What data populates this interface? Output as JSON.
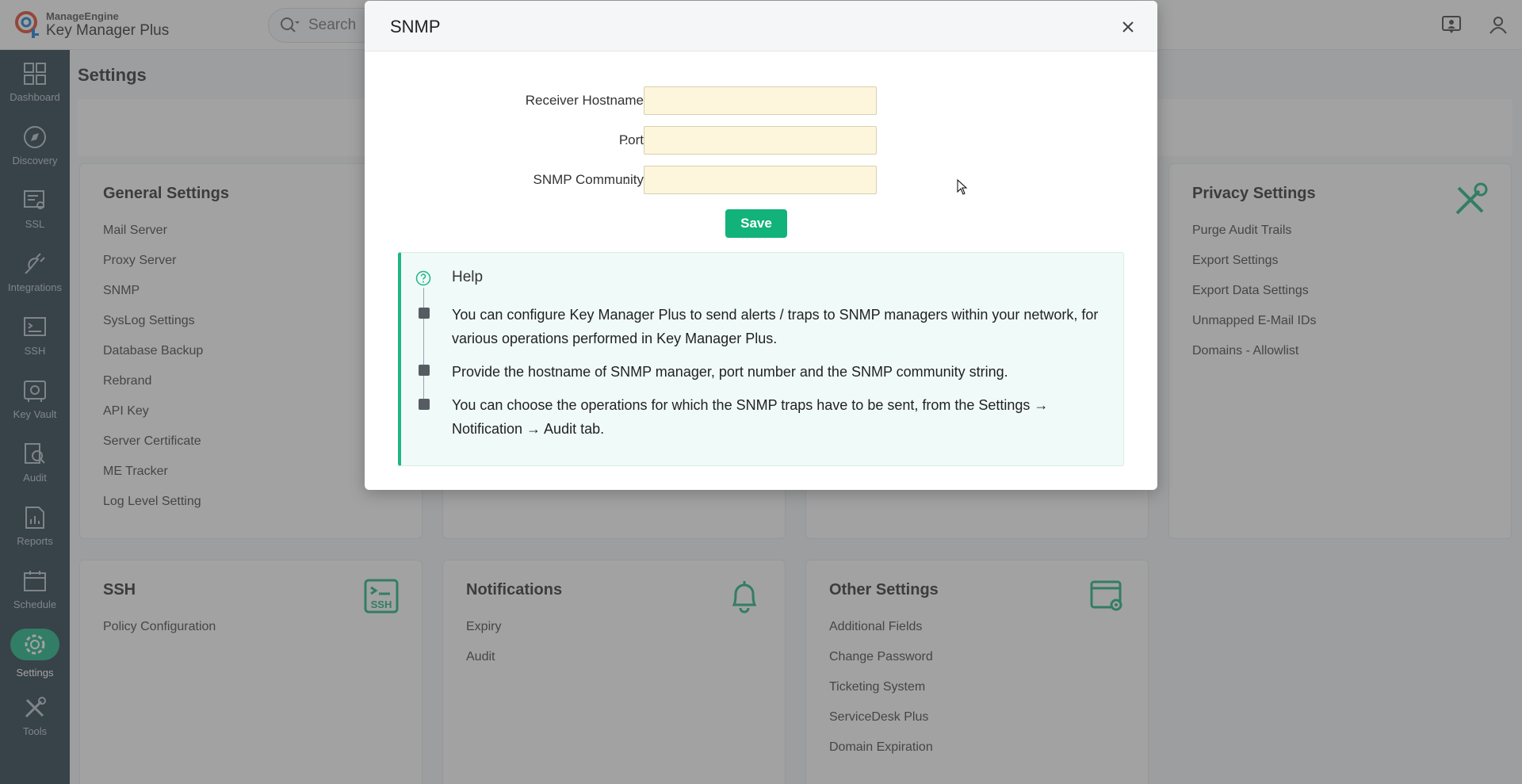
{
  "header": {
    "brand_small": "ManageEngine",
    "brand_big": "Key Manager Plus",
    "search_placeholder": "Search"
  },
  "sidebar": {
    "items": [
      {
        "label": "Dashboard",
        "icon": "dashboard-icon"
      },
      {
        "label": "Discovery",
        "icon": "compass-icon"
      },
      {
        "label": "SSL",
        "icon": "certificate-icon"
      },
      {
        "label": "Integrations",
        "icon": "plug-icon"
      },
      {
        "label": "SSH",
        "icon": "terminal-icon"
      },
      {
        "label": "Key Vault",
        "icon": "vault-icon"
      },
      {
        "label": "Audit",
        "icon": "audit-icon"
      },
      {
        "label": "Reports",
        "icon": "reports-icon"
      },
      {
        "label": "Schedule",
        "icon": "calendar-icon"
      },
      {
        "label": "Settings",
        "icon": "gear-icon",
        "active": true
      },
      {
        "label": "Tools",
        "icon": "tools-icon"
      }
    ]
  },
  "page": {
    "title": "Settings"
  },
  "cards": {
    "general": {
      "title": "General Settings",
      "items": [
        "Mail Server",
        "Proxy Server",
        "SNMP",
        "SysLog Settings",
        "Database Backup",
        "Rebrand",
        "API Key",
        "Server Certificate",
        "ME Tracker",
        "Log Level Setting"
      ]
    },
    "privacy": {
      "title": "Privacy Settings",
      "items": [
        "Purge Audit Trails",
        "Export Settings",
        "Export Data Settings",
        "Unmapped E-Mail IDs",
        "Domains - Allowlist"
      ]
    },
    "ssh": {
      "title": "SSH",
      "items": [
        "Policy Configuration"
      ]
    },
    "notifications": {
      "title": "Notifications",
      "items": [
        "Expiry",
        "Audit"
      ]
    },
    "other": {
      "title": "Other Settings",
      "items": [
        "Additional Fields",
        "Change Password",
        "Ticketing System",
        "ServiceDesk Plus",
        "Domain Expiration"
      ]
    }
  },
  "modal": {
    "title": "SNMP",
    "fields": {
      "hostname_label": "Receiver Hostname",
      "hostname_value": "",
      "port_label": "Port",
      "port_value": "",
      "community_label": "SNMP Community",
      "community_value": "",
      "colon": ":"
    },
    "save_label": "Save",
    "help": {
      "title": "Help",
      "items": [
        "You can configure Key Manager Plus to send alerts / traps to SNMP managers within your network, for various operations performed in Key Manager Plus.",
        "Provide the hostname of SNMP manager, port number and the SNMP community string.",
        "You can choose the operations for which the SNMP traps have to be sent, from the Settings → Notification → Audit tab."
      ]
    }
  },
  "colors": {
    "accent": "#1fb584",
    "sidebar_bg": "#2b3e4c",
    "input_bg": "#fdf6dd",
    "save_btn": "#12b27b"
  }
}
